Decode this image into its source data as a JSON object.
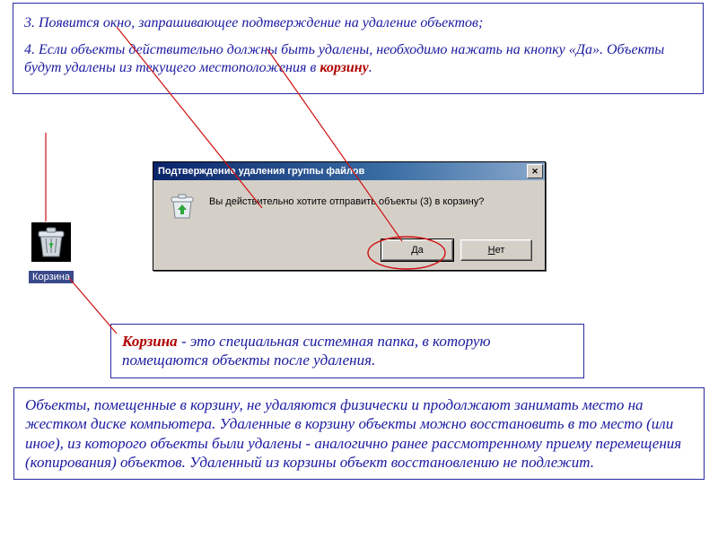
{
  "instructions": {
    "step3": "3. Появится окно, запрашивающее подтверждение на удаление объектов;",
    "step4_part1": "4. Если объекты действительно должны быть удалены, необходимо нажать на кнопку «Да». Объекты будут удалены из текущего местоположения в ",
    "step4_highlight": "корзину",
    "step4_part2": "."
  },
  "trash": {
    "label": "Корзина"
  },
  "dialog": {
    "title": "Подтверждение удаления группы файлов",
    "close_glyph": "✕",
    "message": "Вы действительно хотите отправить объекты (3) в корзину?",
    "yes_label": "Да",
    "no_label": "Нет",
    "yes_hotkey": "Д",
    "no_hotkey": "Н"
  },
  "definition": {
    "lead": "Корзина",
    "body": " - это специальная системная папка, в которую помещаются объекты после удаления."
  },
  "bottom_paragraph": "Объекты, помещенные в корзину, не удаляются  физически и продолжают занимать место на жестком диске компьютера. Удаленные в корзину объекты можно восстановить в то место (или иное), из которого объекты были удалены - аналогично ранее рассмотренному приему перемещения (копирования) объектов. Удаленный из корзины объект восстановлению не подлежит."
}
